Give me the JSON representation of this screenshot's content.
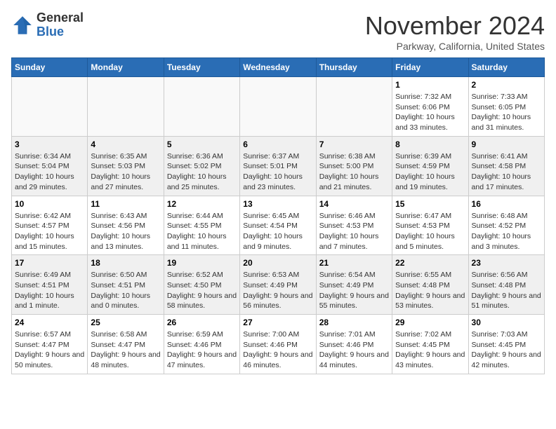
{
  "header": {
    "logo_line1": "General",
    "logo_line2": "Blue",
    "month": "November 2024",
    "location": "Parkway, California, United States"
  },
  "weekdays": [
    "Sunday",
    "Monday",
    "Tuesday",
    "Wednesday",
    "Thursday",
    "Friday",
    "Saturday"
  ],
  "weeks": [
    [
      {
        "day": "",
        "info": ""
      },
      {
        "day": "",
        "info": ""
      },
      {
        "day": "",
        "info": ""
      },
      {
        "day": "",
        "info": ""
      },
      {
        "day": "",
        "info": ""
      },
      {
        "day": "1",
        "info": "Sunrise: 7:32 AM\nSunset: 6:06 PM\nDaylight: 10 hours and 33 minutes."
      },
      {
        "day": "2",
        "info": "Sunrise: 7:33 AM\nSunset: 6:05 PM\nDaylight: 10 hours and 31 minutes."
      }
    ],
    [
      {
        "day": "3",
        "info": "Sunrise: 6:34 AM\nSunset: 5:04 PM\nDaylight: 10 hours and 29 minutes."
      },
      {
        "day": "4",
        "info": "Sunrise: 6:35 AM\nSunset: 5:03 PM\nDaylight: 10 hours and 27 minutes."
      },
      {
        "day": "5",
        "info": "Sunrise: 6:36 AM\nSunset: 5:02 PM\nDaylight: 10 hours and 25 minutes."
      },
      {
        "day": "6",
        "info": "Sunrise: 6:37 AM\nSunset: 5:01 PM\nDaylight: 10 hours and 23 minutes."
      },
      {
        "day": "7",
        "info": "Sunrise: 6:38 AM\nSunset: 5:00 PM\nDaylight: 10 hours and 21 minutes."
      },
      {
        "day": "8",
        "info": "Sunrise: 6:39 AM\nSunset: 4:59 PM\nDaylight: 10 hours and 19 minutes."
      },
      {
        "day": "9",
        "info": "Sunrise: 6:41 AM\nSunset: 4:58 PM\nDaylight: 10 hours and 17 minutes."
      }
    ],
    [
      {
        "day": "10",
        "info": "Sunrise: 6:42 AM\nSunset: 4:57 PM\nDaylight: 10 hours and 15 minutes."
      },
      {
        "day": "11",
        "info": "Sunrise: 6:43 AM\nSunset: 4:56 PM\nDaylight: 10 hours and 13 minutes."
      },
      {
        "day": "12",
        "info": "Sunrise: 6:44 AM\nSunset: 4:55 PM\nDaylight: 10 hours and 11 minutes."
      },
      {
        "day": "13",
        "info": "Sunrise: 6:45 AM\nSunset: 4:54 PM\nDaylight: 10 hours and 9 minutes."
      },
      {
        "day": "14",
        "info": "Sunrise: 6:46 AM\nSunset: 4:53 PM\nDaylight: 10 hours and 7 minutes."
      },
      {
        "day": "15",
        "info": "Sunrise: 6:47 AM\nSunset: 4:53 PM\nDaylight: 10 hours and 5 minutes."
      },
      {
        "day": "16",
        "info": "Sunrise: 6:48 AM\nSunset: 4:52 PM\nDaylight: 10 hours and 3 minutes."
      }
    ],
    [
      {
        "day": "17",
        "info": "Sunrise: 6:49 AM\nSunset: 4:51 PM\nDaylight: 10 hours and 1 minute."
      },
      {
        "day": "18",
        "info": "Sunrise: 6:50 AM\nSunset: 4:51 PM\nDaylight: 10 hours and 0 minutes."
      },
      {
        "day": "19",
        "info": "Sunrise: 6:52 AM\nSunset: 4:50 PM\nDaylight: 9 hours and 58 minutes."
      },
      {
        "day": "20",
        "info": "Sunrise: 6:53 AM\nSunset: 4:49 PM\nDaylight: 9 hours and 56 minutes."
      },
      {
        "day": "21",
        "info": "Sunrise: 6:54 AM\nSunset: 4:49 PM\nDaylight: 9 hours and 55 minutes."
      },
      {
        "day": "22",
        "info": "Sunrise: 6:55 AM\nSunset: 4:48 PM\nDaylight: 9 hours and 53 minutes."
      },
      {
        "day": "23",
        "info": "Sunrise: 6:56 AM\nSunset: 4:48 PM\nDaylight: 9 hours and 51 minutes."
      }
    ],
    [
      {
        "day": "24",
        "info": "Sunrise: 6:57 AM\nSunset: 4:47 PM\nDaylight: 9 hours and 50 minutes."
      },
      {
        "day": "25",
        "info": "Sunrise: 6:58 AM\nSunset: 4:47 PM\nDaylight: 9 hours and 48 minutes."
      },
      {
        "day": "26",
        "info": "Sunrise: 6:59 AM\nSunset: 4:46 PM\nDaylight: 9 hours and 47 minutes."
      },
      {
        "day": "27",
        "info": "Sunrise: 7:00 AM\nSunset: 4:46 PM\nDaylight: 9 hours and 46 minutes."
      },
      {
        "day": "28",
        "info": "Sunrise: 7:01 AM\nSunset: 4:46 PM\nDaylight: 9 hours and 44 minutes."
      },
      {
        "day": "29",
        "info": "Sunrise: 7:02 AM\nSunset: 4:45 PM\nDaylight: 9 hours and 43 minutes."
      },
      {
        "day": "30",
        "info": "Sunrise: 7:03 AM\nSunset: 4:45 PM\nDaylight: 9 hours and 42 minutes."
      }
    ]
  ]
}
